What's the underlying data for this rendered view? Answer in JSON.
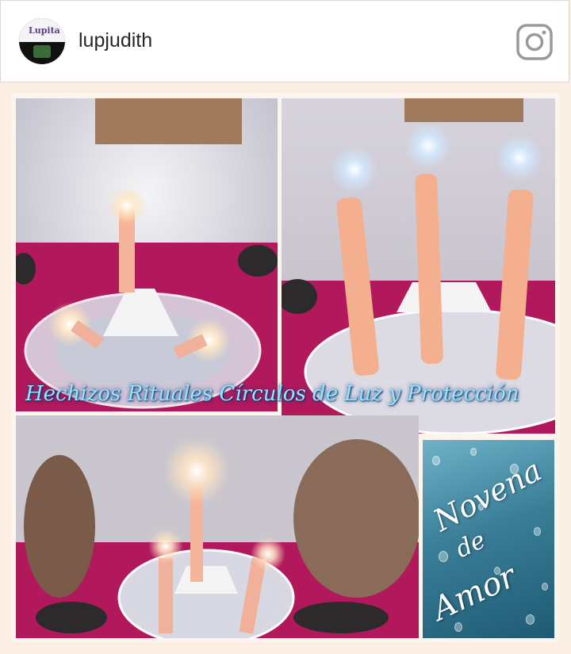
{
  "post": {
    "username": "lupjudith",
    "avatar_text": "Lupita",
    "icon": "instagram-icon"
  },
  "collage": {
    "caption": "Hechizos Rituales Círculos de Luz y Protección",
    "novena_line1": "Novena",
    "novena_line2": "de",
    "novena_line3": "Amor"
  }
}
